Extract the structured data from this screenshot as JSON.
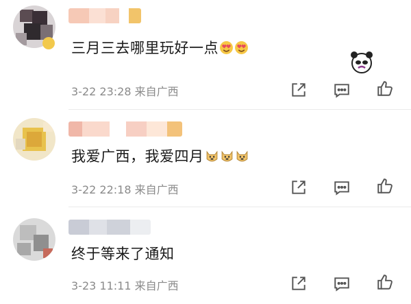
{
  "comments": [
    {
      "text": "三月三去哪里玩好一点",
      "emoji": "heart-eyes",
      "meta": "3-22 23:28  来自广西"
    },
    {
      "text": "我爱广西，我爱四月",
      "emoji": "doge",
      "meta": "3-22 22:18  来自广西"
    },
    {
      "text": "终于等来了通知",
      "emoji": "",
      "meta": "3-23 11:11  来自广西"
    }
  ],
  "icons": {
    "share": "share-icon",
    "comment": "comment-icon",
    "like": "like-icon"
  },
  "colors": {
    "text": "#1a1a1a",
    "meta": "#8a8a8a",
    "icon": "#555555",
    "divider": "#ebebeb"
  }
}
